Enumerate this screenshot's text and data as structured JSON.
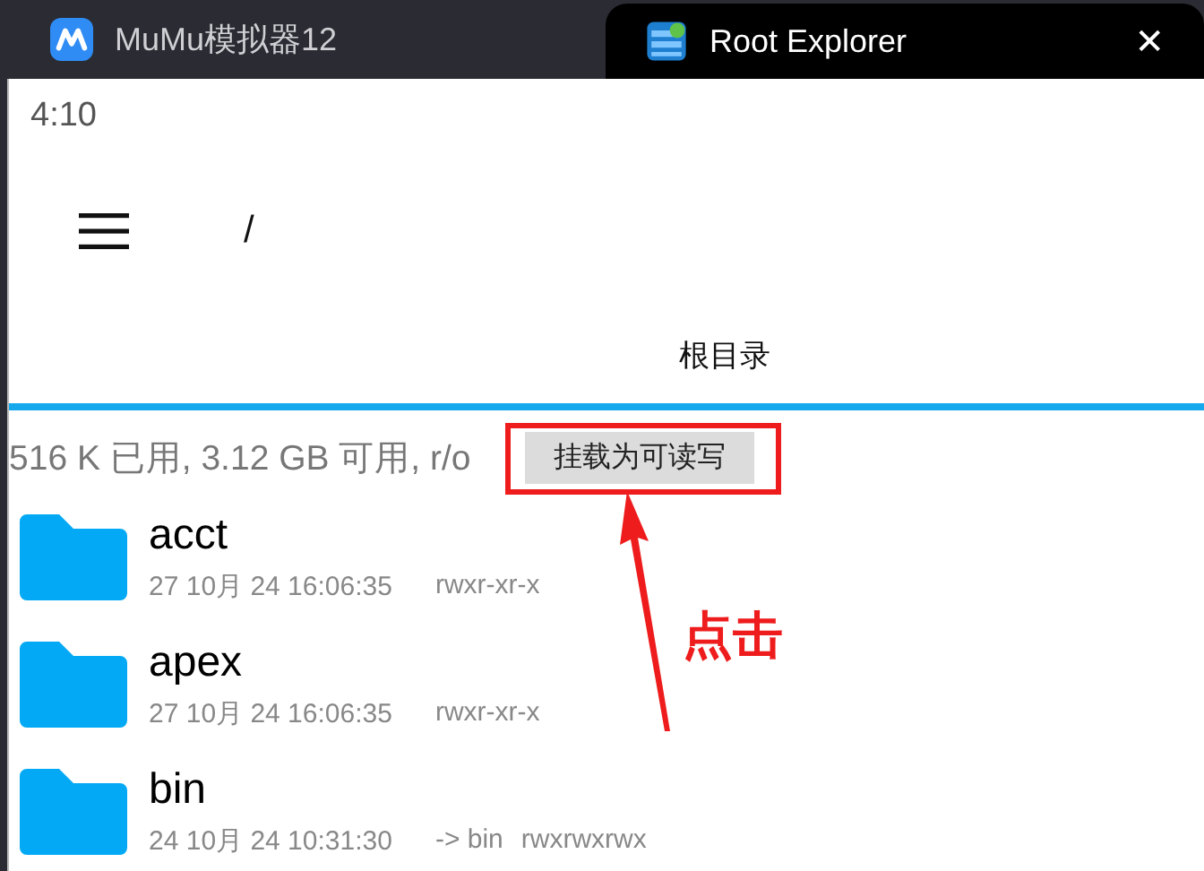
{
  "window_tabs": [
    {
      "label": "MuMu模拟器12",
      "selected": false,
      "closable": false
    },
    {
      "label": "Root Explorer",
      "selected": true,
      "closable": true,
      "close": "✕"
    }
  ],
  "status_bar": {
    "time": "4:10"
  },
  "toolbar": {
    "path": "/"
  },
  "section_tab": {
    "label": "根目录",
    "selected": true
  },
  "storage_info": "516 K 已用, 3.12 GB 可用, r/o",
  "mount_button": "挂载为可读写",
  "files": [
    {
      "name": "acct",
      "date": "27 10月 24 16:06:35",
      "permissions": "rwxr-xr-x"
    },
    {
      "name": "apex",
      "date": "27 10月 24 16:06:35",
      "permissions": "rwxr-xr-x"
    },
    {
      "name": "bin",
      "date": "24 10月 24 10:31:30",
      "link": "-> bin",
      "permissions": "rwxrwxrwx"
    }
  ],
  "annotation": {
    "label": "点击"
  }
}
